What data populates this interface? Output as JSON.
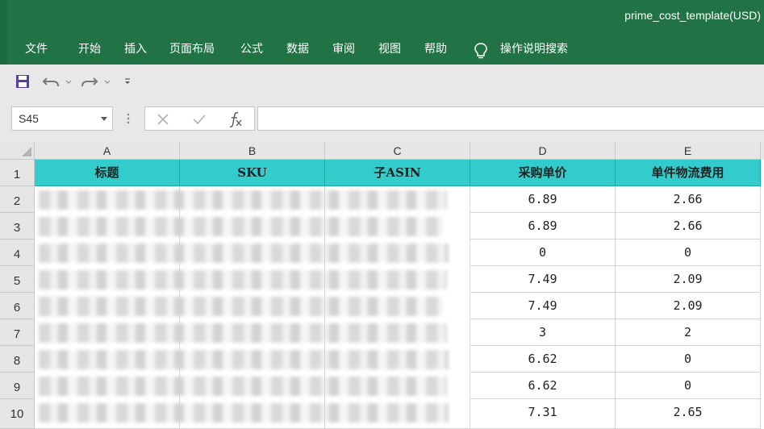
{
  "window": {
    "title": "prime_cost_template(USD)"
  },
  "ribbon": {
    "tabs": [
      "文件",
      "开始",
      "插入",
      "页面布局",
      "公式",
      "数据",
      "审阅",
      "视图",
      "帮助"
    ],
    "search_label": "操作说明搜索"
  },
  "formula_bar": {
    "name_box": "S45",
    "content": ""
  },
  "sheet": {
    "columns": [
      "A",
      "B",
      "C",
      "D",
      "E"
    ],
    "rows": [
      "1",
      "2",
      "3",
      "4",
      "5",
      "6",
      "7",
      "8",
      "9",
      "10"
    ],
    "headers": [
      "标题",
      "SKU",
      "子ASIN",
      "采购单价",
      "单件物流费用"
    ],
    "data": [
      {
        "d": "6.89",
        "e": "2.66"
      },
      {
        "d": "6.89",
        "e": "2.66"
      },
      {
        "d": "0",
        "e": "0"
      },
      {
        "d": "7.49",
        "e": "2.09"
      },
      {
        "d": "7.49",
        "e": "2.09"
      },
      {
        "d": "3",
        "e": "2"
      },
      {
        "d": "6.62",
        "e": "0"
      },
      {
        "d": "6.62",
        "e": "0"
      },
      {
        "d": "7.31",
        "e": "2.65"
      }
    ]
  },
  "colors": {
    "title_bar": "#217346",
    "header_fill": "#33cccc"
  }
}
